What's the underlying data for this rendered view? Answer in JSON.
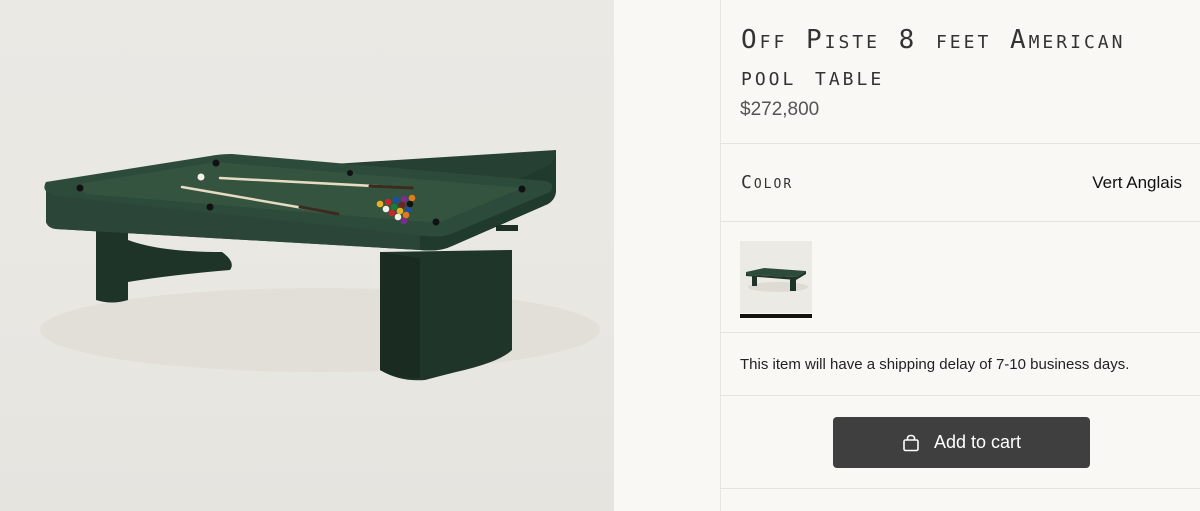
{
  "product": {
    "title": "Off Piste 8 feet American pool table",
    "price": "$272,800",
    "image_alt": "green pool table"
  },
  "options": {
    "color_label": "Color",
    "color_value": "Vert Anglais",
    "swatches": [
      {
        "name": "Vert Anglais",
        "selected": true
      }
    ]
  },
  "shipping": {
    "message": "This item will have a shipping delay of 7-10 business days."
  },
  "actions": {
    "add_to_cart_label": "Add to cart",
    "add_to_cart_icon": "shopping-bag-icon"
  },
  "colors": {
    "table_felt": "#2f4a3b",
    "table_body": "#24382d",
    "button_bg": "#3f3f3f",
    "page_bg": "#f9f8f4",
    "image_bg": "#e9e7e2"
  }
}
